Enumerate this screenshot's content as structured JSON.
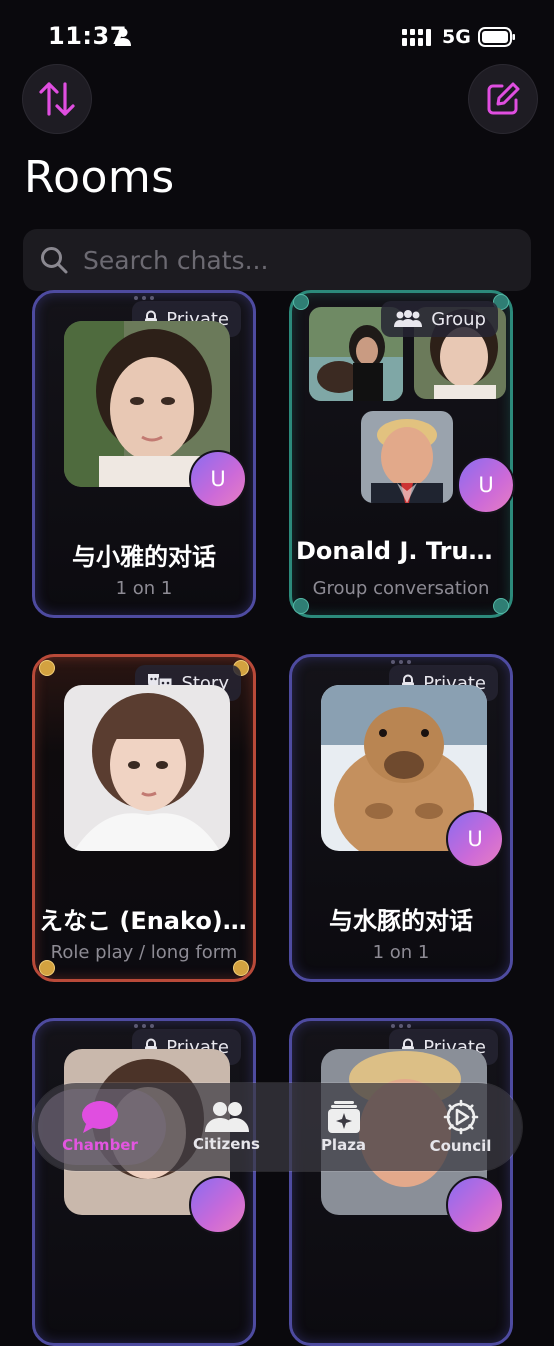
{
  "status_bar": {
    "time": "11:37",
    "network": "5G"
  },
  "header": {
    "title": "Rooms"
  },
  "search": {
    "placeholder": "Search chats..."
  },
  "rooms": [
    {
      "type": "Private",
      "name": "与小雅的对话",
      "subtitle": "1 on 1",
      "avatar_initial": "U"
    },
    {
      "type": "Group",
      "name": "Donald J. Trum...",
      "subtitle": "Group conversation",
      "avatar_initial": "U"
    },
    {
      "type": "Story",
      "name": "えなこ (Enako)...",
      "subtitle": "Role play / long form"
    },
    {
      "type": "Private",
      "name": "与水豚的对话",
      "subtitle": "1 on 1",
      "avatar_initial": "U"
    },
    {
      "type": "Private",
      "name": "",
      "subtitle": ""
    },
    {
      "type": "Private",
      "name": "",
      "subtitle": ""
    }
  ],
  "nav": {
    "items": [
      {
        "label": "Chamber",
        "icon": "chat-bubble-icon",
        "active": true
      },
      {
        "label": "Citizens",
        "icon": "people-icon",
        "active": false
      },
      {
        "label": "Plaza",
        "icon": "sparkle-cards-icon",
        "active": false
      },
      {
        "label": "Council",
        "icon": "gear-play-icon",
        "active": false
      }
    ]
  },
  "colors": {
    "accent": "#e04ee0",
    "private_border": "#4e4ba0",
    "group_border": "#2c8a7b",
    "story_border": "#b94a39",
    "background": "#0a090d"
  }
}
